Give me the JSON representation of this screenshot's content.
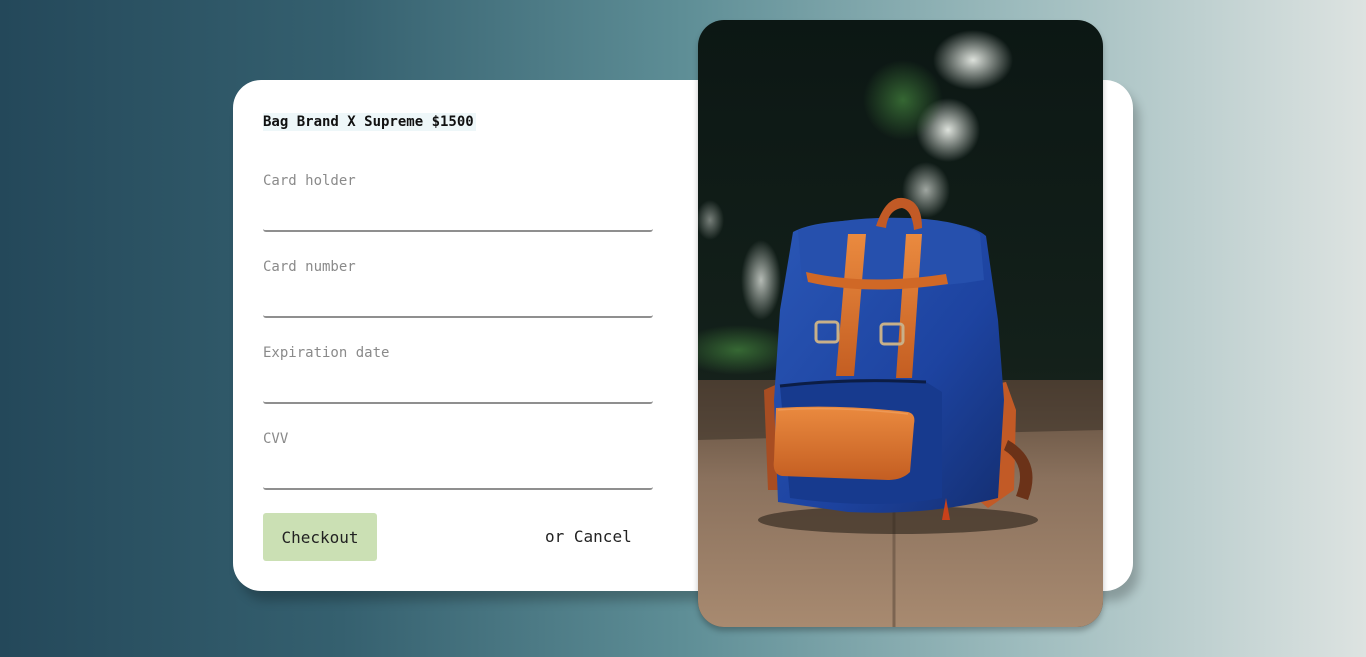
{
  "product": {
    "title": "Bag Brand X Supreme $1500"
  },
  "form": {
    "fields": [
      {
        "label": "Card holder",
        "value": ""
      },
      {
        "label": "Card number",
        "value": ""
      },
      {
        "label": "Expiration date",
        "value": ""
      },
      {
        "label": "CVV",
        "value": ""
      }
    ]
  },
  "actions": {
    "checkout_label": "Checkout",
    "or_text": "or",
    "cancel_label": "Cancel"
  },
  "colors": {
    "checkout_button": "#cbe0b4",
    "backpack_blue": "#1f46a0",
    "leather_orange": "#d9702a"
  },
  "image": {
    "subject": "backpack-photo"
  }
}
